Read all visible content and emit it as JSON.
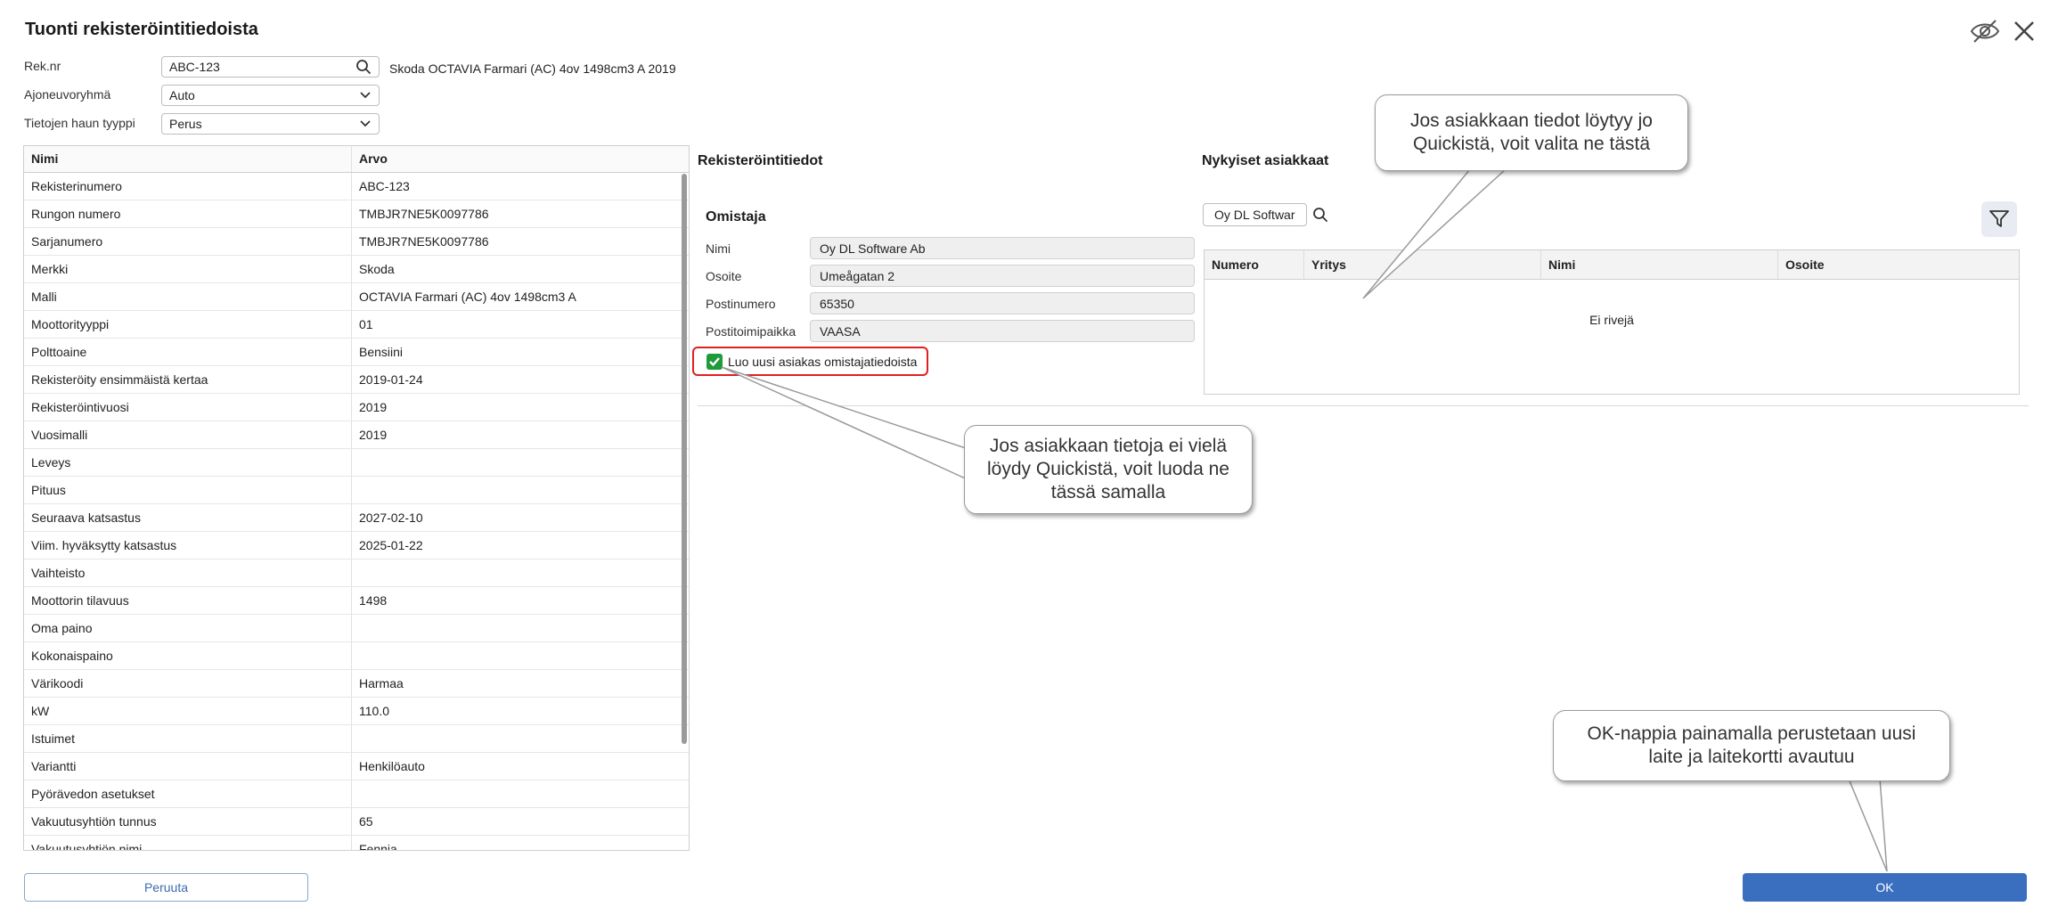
{
  "dialog": {
    "title": "Tuonti rekisteröintitiedoista"
  },
  "form": {
    "regnr_label": "Rek.nr",
    "regnr_value": "ABC-123",
    "vehicle_description": "Skoda OCTAVIA Farmari (AC) 4ov 1498cm3 A 2019",
    "group_label": "Ajoneuvoryhmä",
    "group_value": "Auto",
    "query_type_label": "Tietojen haun tyyppi",
    "query_type_value": "Perus"
  },
  "table": {
    "headers": [
      "Nimi",
      "Arvo"
    ],
    "rows": [
      [
        "Rekisterinumero",
        "ABC-123"
      ],
      [
        "Rungon numero",
        "TMBJR7NE5K0097786"
      ],
      [
        "Sarjanumero",
        "TMBJR7NE5K0097786"
      ],
      [
        "Merkki",
        "Skoda"
      ],
      [
        "Malli",
        "OCTAVIA Farmari (AC) 4ov 1498cm3 A"
      ],
      [
        "Moottorityyppi",
        "01"
      ],
      [
        "Polttoaine",
        "Bensiini"
      ],
      [
        "Rekisteröity ensimmäistä kertaa",
        "2019-01-24"
      ],
      [
        "Rekisteröintivuosi",
        "2019"
      ],
      [
        "Vuosimalli",
        "2019"
      ],
      [
        "Leveys",
        ""
      ],
      [
        "Pituus",
        ""
      ],
      [
        "Seuraava katsastus",
        "2027-02-10"
      ],
      [
        "Viim. hyväksytty katsastus",
        "2025-01-22"
      ],
      [
        "Vaihteisto",
        ""
      ],
      [
        "Moottorin tilavuus",
        "1498"
      ],
      [
        "Oma paino",
        ""
      ],
      [
        "Kokonaispaino",
        ""
      ],
      [
        "Värikoodi",
        "Harmaa"
      ],
      [
        "kW",
        "110.0"
      ],
      [
        "Istuimet",
        ""
      ],
      [
        "Variantti",
        "Henkilöauto"
      ],
      [
        "Pyörävedon asetukset",
        ""
      ],
      [
        "Vakuutusyhtiön tunnus",
        "65"
      ],
      [
        "Vakuutusyhtiön nimi",
        "Fennia"
      ]
    ]
  },
  "registration": {
    "section_title": "Rekisteröintitiedot",
    "owner_title": "Omistaja",
    "fields": [
      {
        "label": "Nimi",
        "value": "Oy DL Software Ab"
      },
      {
        "label": "Osoite",
        "value": "Umeågatan 2"
      },
      {
        "label": "Postinumero",
        "value": "65350"
      },
      {
        "label": "Postitoimipaikka",
        "value": "VAASA"
      }
    ],
    "checkbox_label": "Luo uusi asiakas omistajatiedoista"
  },
  "customers": {
    "section_title": "Nykyiset asiakkaat",
    "search_value": "Oy DL Software",
    "headers": [
      "Numero",
      "Yritys",
      "Nimi",
      "Osoite"
    ],
    "empty_text": "Ei rivejä"
  },
  "callouts": {
    "existing": "Jos asiakkaan tiedot löytyy jo Quickistä, voit valita ne tästä",
    "create": "Jos asiakkaan tietoja ei vielä löydy Quickistä, voit luoda ne tässä samalla",
    "ok": "OK-nappia painamalla perustetaan uusi laite ja laitekortti avautuu"
  },
  "buttons": {
    "cancel": "Peruuta",
    "ok": "OK"
  },
  "icons": [
    "eye-off-icon",
    "close-icon",
    "search-icon",
    "chevron-down-icon",
    "filter-icon",
    "checkmark-icon"
  ],
  "colors": {
    "primary": "#3a6fbf",
    "checkbox": "#1f9b3a",
    "highlight": "#e02020"
  }
}
